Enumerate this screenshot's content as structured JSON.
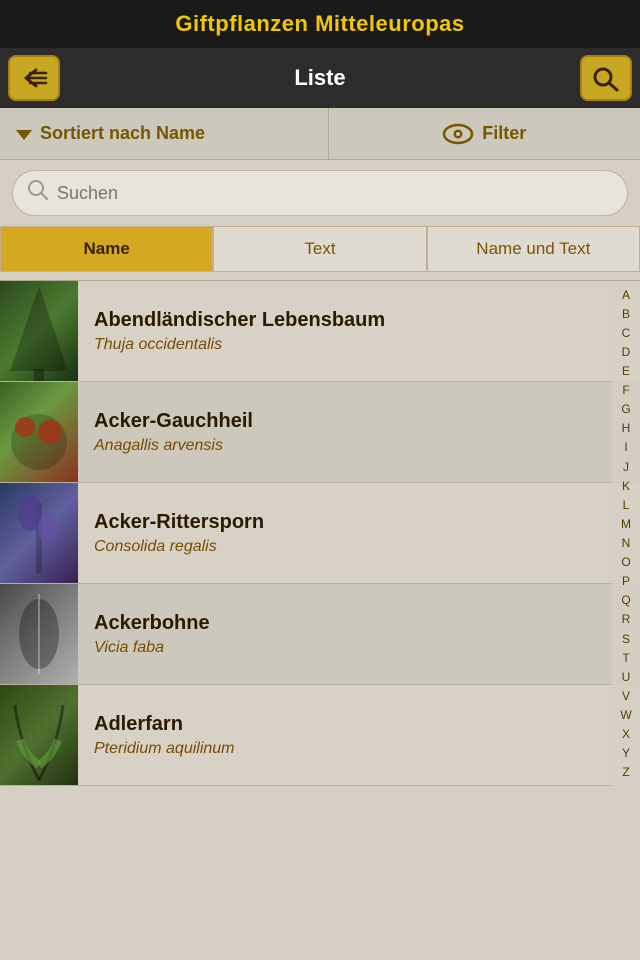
{
  "app": {
    "title": "Giftpflanzen Mitteleuropas"
  },
  "nav": {
    "title": "Liste",
    "back_icon": "back-menu-icon",
    "search_icon": "search-icon"
  },
  "sort_filter": {
    "sort_label": "Sortiert nach Name",
    "filter_label": "Filter"
  },
  "search": {
    "placeholder": "Suchen"
  },
  "tabs": [
    {
      "id": "name",
      "label": "Name",
      "active": true
    },
    {
      "id": "text",
      "label": "Text",
      "active": false
    },
    {
      "id": "name_und_text",
      "label": "Name und Text",
      "active": false
    }
  ],
  "plants": [
    {
      "id": 1,
      "name": "Abendländischer Lebensbaum",
      "latin": "Thuja occidentalis",
      "img_class": "plant-img-1"
    },
    {
      "id": 2,
      "name": "Acker-Gauchheil",
      "latin": "Anagallis arvensis",
      "img_class": "plant-img-2"
    },
    {
      "id": 3,
      "name": "Acker-Rittersporn",
      "latin": "Consolida regalis",
      "img_class": "plant-img-3"
    },
    {
      "id": 4,
      "name": "Ackerbohne",
      "latin": "Vicia faba",
      "img_class": "plant-img-4"
    },
    {
      "id": 5,
      "name": "Adlerfarn",
      "latin": "Pteridium aquilinum",
      "img_class": "plant-img-5"
    }
  ],
  "alphabet": [
    "A",
    "B",
    "C",
    "D",
    "E",
    "F",
    "G",
    "H",
    "I",
    "J",
    "K",
    "L",
    "M",
    "N",
    "O",
    "P",
    "Q",
    "R",
    "S",
    "T",
    "U",
    "V",
    "W",
    "X",
    "Y",
    "Z"
  ]
}
